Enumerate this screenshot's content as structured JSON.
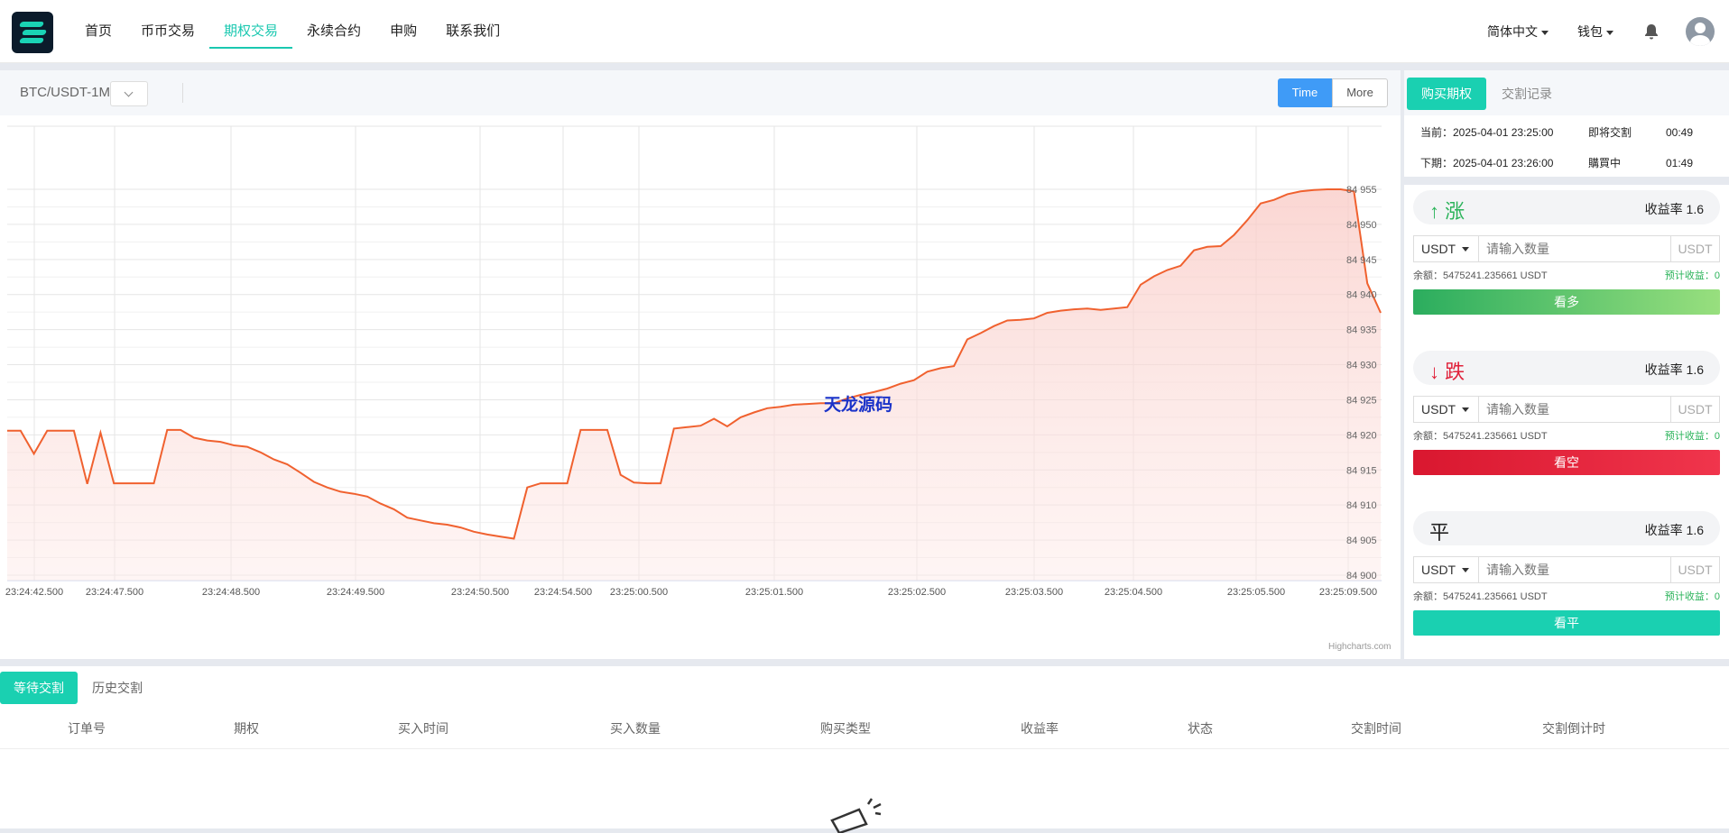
{
  "nav": {
    "items": [
      "首页",
      "币币交易",
      "期权交易",
      "永续合约",
      "申购",
      "联系我们"
    ],
    "active": 2
  },
  "header": {
    "lang": "简体中文",
    "wallet": "钱包",
    "icons": [
      "bell-icon",
      "avatar-icon"
    ]
  },
  "chart_toolbar": {
    "pair": "BTC/USDT-1M",
    "time_button": "Time",
    "more_button": "More"
  },
  "watermark": "天龙源码",
  "credit": "Highcharts.com",
  "colors": {
    "accent": "#1ad0b1",
    "line": "#f0612f",
    "up": "#2bb35a",
    "down": "#e0213a",
    "blue": "#3f9bf7"
  },
  "chart_data": {
    "type": "area",
    "x_ticks": [
      "23:24:42.500",
      "23:24:47.500",
      "23:24:48.500",
      "23:24:49.500",
      "23:24:50.500",
      "23:24:54.500",
      "23:25:00.500",
      "23:25:01.500",
      "23:25:02.500",
      "23:25:03.500",
      "23:25:04.500",
      "23:25:05.500",
      "23:25:09.500"
    ],
    "y_ticks": [
      "84 955",
      "84 950",
      "84 945",
      "84 940",
      "84 935",
      "84 930",
      "84 925",
      "84 920",
      "84 915",
      "84 910",
      "84 905",
      "84 900"
    ],
    "ylim": [
      84900,
      84955
    ],
    "series": [
      {
        "values": [
          84920.6,
          84920.6,
          84917.3,
          84920.6,
          84920.6,
          84920.6,
          84913.0,
          84920.3,
          84913.1,
          84913.1,
          84913.1,
          84913.1,
          84920.7,
          84920.7,
          84919.6,
          84919.2,
          84919.0,
          84918.5,
          84918.3,
          84917.5,
          84916.5,
          84915.8,
          84914.6,
          84913.3,
          84912.5,
          84911.9,
          84911.6,
          84911.2,
          84910.2,
          84909.4,
          84908.2,
          84907.8,
          84907.4,
          84907.2,
          84906.8,
          84906.2,
          84905.8,
          84905.5,
          84905.2,
          84912.5,
          84913.1,
          84913.1,
          84913.1,
          84920.7,
          84920.7,
          84920.7,
          84914.3,
          84913.2,
          84913.1,
          84913.1,
          84920.9,
          84921.1,
          84921.3,
          84922.3,
          84921.2,
          84922.5,
          84923.2,
          84923.8,
          84924.0,
          84924.3,
          84924.4,
          84924.5,
          84924.5,
          84925.2,
          84925.7,
          84926.1,
          84926.6,
          84927.3,
          84927.8,
          84929.0,
          84929.5,
          84929.8,
          84933.6,
          84934.5,
          84935.5,
          84936.3,
          84936.4,
          84936.6,
          84937.4,
          84937.7,
          84937.9,
          84938.0,
          84937.8,
          84938.0,
          84938.2,
          84941.4,
          84942.6,
          84943.5,
          84944.1,
          84946.3,
          84946.8,
          84946.9,
          84948.5,
          84950.6,
          84953.0,
          84953.5,
          84954.3,
          84954.7,
          84954.9,
          84955.0,
          84955.0,
          84954.7,
          84941.6,
          84937.4
        ]
      }
    ]
  },
  "side": {
    "tabs": [
      "购买期权",
      "交割记录"
    ],
    "current": {
      "label": "当前：2025-04-01 23:25:00",
      "state": "即将交割",
      "countdown": "00:49"
    },
    "next": {
      "label": "下期：2025-04-01 23:26:00",
      "state": "購買中",
      "countdown": "01:49"
    },
    "cards": [
      {
        "dir": "↑ 涨",
        "rate": "收益率 1.6",
        "unit": "USDT",
        "placeholder": "请输入数量",
        "unit2": "USDT",
        "balance": "余额：5475241.235661 USDT",
        "est": "预计收益：0",
        "button": "看多"
      },
      {
        "dir": "↓ 跌",
        "rate": "收益率 1.6",
        "unit": "USDT",
        "placeholder": "请输入数量",
        "unit2": "USDT",
        "balance": "余额：5475241.235661 USDT",
        "est": "预计收益：0",
        "button": "看空"
      },
      {
        "dir": "平",
        "rate": "收益率 1.6",
        "unit": "USDT",
        "placeholder": "请输入数量",
        "unit2": "USDT",
        "balance": "余额：5475241.235661 USDT",
        "est": "预计收益：0",
        "button": "看平"
      }
    ]
  },
  "orders": {
    "tabs": [
      "等待交割",
      "历史交割"
    ],
    "columns": [
      "订单号",
      "期权",
      "买入时间",
      "买入数量",
      "购买类型",
      "收益率",
      "状态",
      "交割时间",
      "交割倒计时"
    ]
  }
}
